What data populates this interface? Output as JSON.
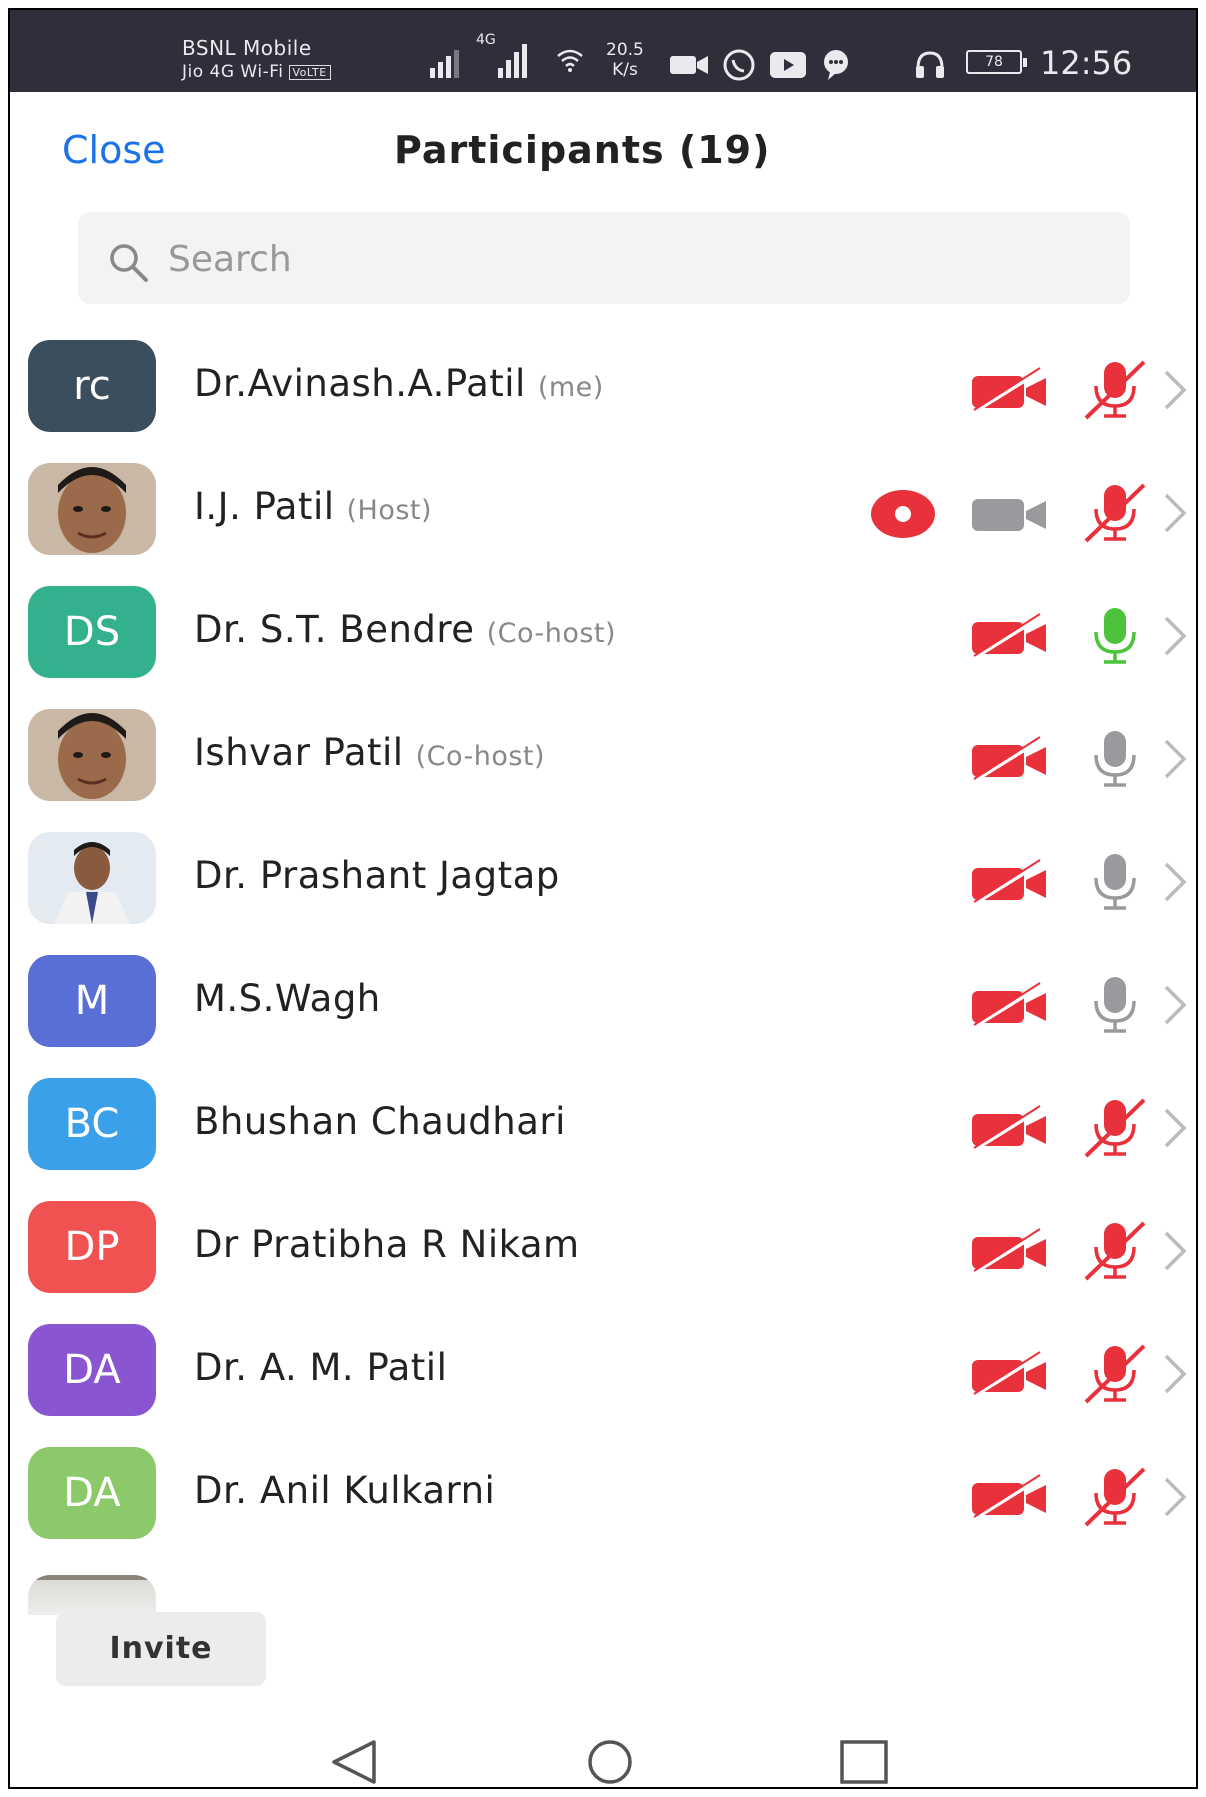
{
  "status_bar": {
    "carrier_line1": "BSNL Mobile",
    "carrier_line2": "Jio 4G Wi-Fi",
    "volte_badge": "VoLTE",
    "network_label": "4G",
    "speed_value": "20.5",
    "speed_unit": "K/s",
    "battery": "78",
    "time": "12:56"
  },
  "header": {
    "close_label": "Close",
    "title": "Participants (19)"
  },
  "search": {
    "placeholder": "Search"
  },
  "participants": [
    {
      "initials": "rc",
      "avatar_color": "#3b4e5e",
      "name": "Dr.Avinash.A.Patil",
      "tag": "(me)",
      "video": "off",
      "mic": "muted",
      "recording": false
    },
    {
      "initials": "",
      "avatar_type": "photo",
      "name": "I.J. Patil",
      "tag": "(Host)",
      "video": "on",
      "mic": "muted",
      "recording": true
    },
    {
      "initials": "DS",
      "avatar_color": "#33b08e",
      "name": "Dr. S.T. Bendre",
      "tag": "(Co-host)",
      "video": "off",
      "mic": "speaking",
      "recording": false
    },
    {
      "initials": "",
      "avatar_type": "photo",
      "name": "Ishvar Patil",
      "tag": "(Co-host)",
      "video": "off",
      "mic": "unmuted",
      "recording": false
    },
    {
      "initials": "",
      "avatar_type": "photo",
      "name": "Dr. Prashant Jagtap",
      "tag": "",
      "video": "off",
      "mic": "unmuted",
      "recording": false
    },
    {
      "initials": "M",
      "avatar_color": "#5a6fd6",
      "name": "M.S.Wagh",
      "tag": "",
      "video": "off",
      "mic": "unmuted",
      "recording": false
    },
    {
      "initials": "BC",
      "avatar_color": "#3aa0ea",
      "name": "Bhushan Chaudhari",
      "tag": "",
      "video": "off",
      "mic": "muted",
      "recording": false
    },
    {
      "initials": "DP",
      "avatar_color": "#f05252",
      "name": "Dr Pratibha R Nikam",
      "tag": "",
      "video": "off",
      "mic": "muted",
      "recording": false
    },
    {
      "initials": "DA",
      "avatar_color": "#8a55d0",
      "name": "Dr. A. M. Patil",
      "tag": "",
      "video": "off",
      "mic": "muted",
      "recording": false
    },
    {
      "initials": "DA",
      "avatar_color": "#8cc96a",
      "name": "Dr. Anil Kulkarni",
      "tag": "",
      "video": "off",
      "mic": "muted",
      "recording": false
    }
  ],
  "footer": {
    "invite_label": "Invite"
  },
  "colors": {
    "accent": "#1a73e8",
    "muted_red": "#e8313b",
    "speaking_green": "#4cc33a",
    "neutral_gray": "#9a9a9e"
  }
}
